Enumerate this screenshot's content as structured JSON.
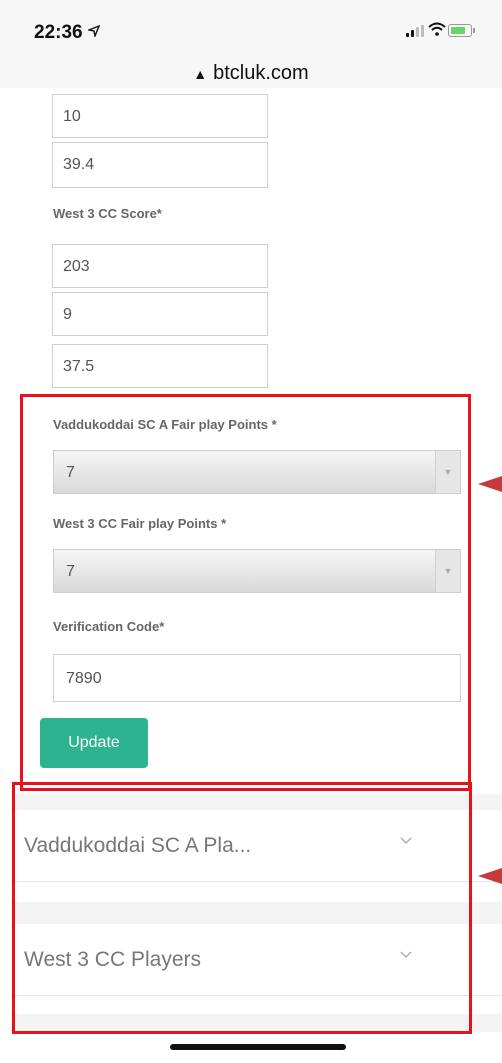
{
  "status_bar": {
    "time": "22:36",
    "location_arrow": "location-arrow-icon"
  },
  "url_bar": {
    "domain": "btcluk.com",
    "lock_icon": "▲"
  },
  "scores": {
    "first_team_values": [
      "10",
      "39.4"
    ],
    "second_team_label": "West 3 CC Score*",
    "second_team_values": [
      "203",
      "9",
      "37.5"
    ]
  },
  "fair_play": {
    "team_a_label": "Vaddukoddai SC A Fair play Points *",
    "team_a_value": "7",
    "team_b_label": "West 3 CC Fair play Points *",
    "team_b_value": "7"
  },
  "verification": {
    "label": "Verification Code*",
    "value": "7890"
  },
  "update_button": {
    "label": "Update"
  },
  "accordions": [
    {
      "title": "Vaddukoddai SC A Pla..."
    },
    {
      "title": "West 3 CC Players"
    }
  ],
  "colors": {
    "accent_button": "#2db38f",
    "highlight_box": "#e8121c",
    "annotation_arrow": "#c8393e"
  }
}
